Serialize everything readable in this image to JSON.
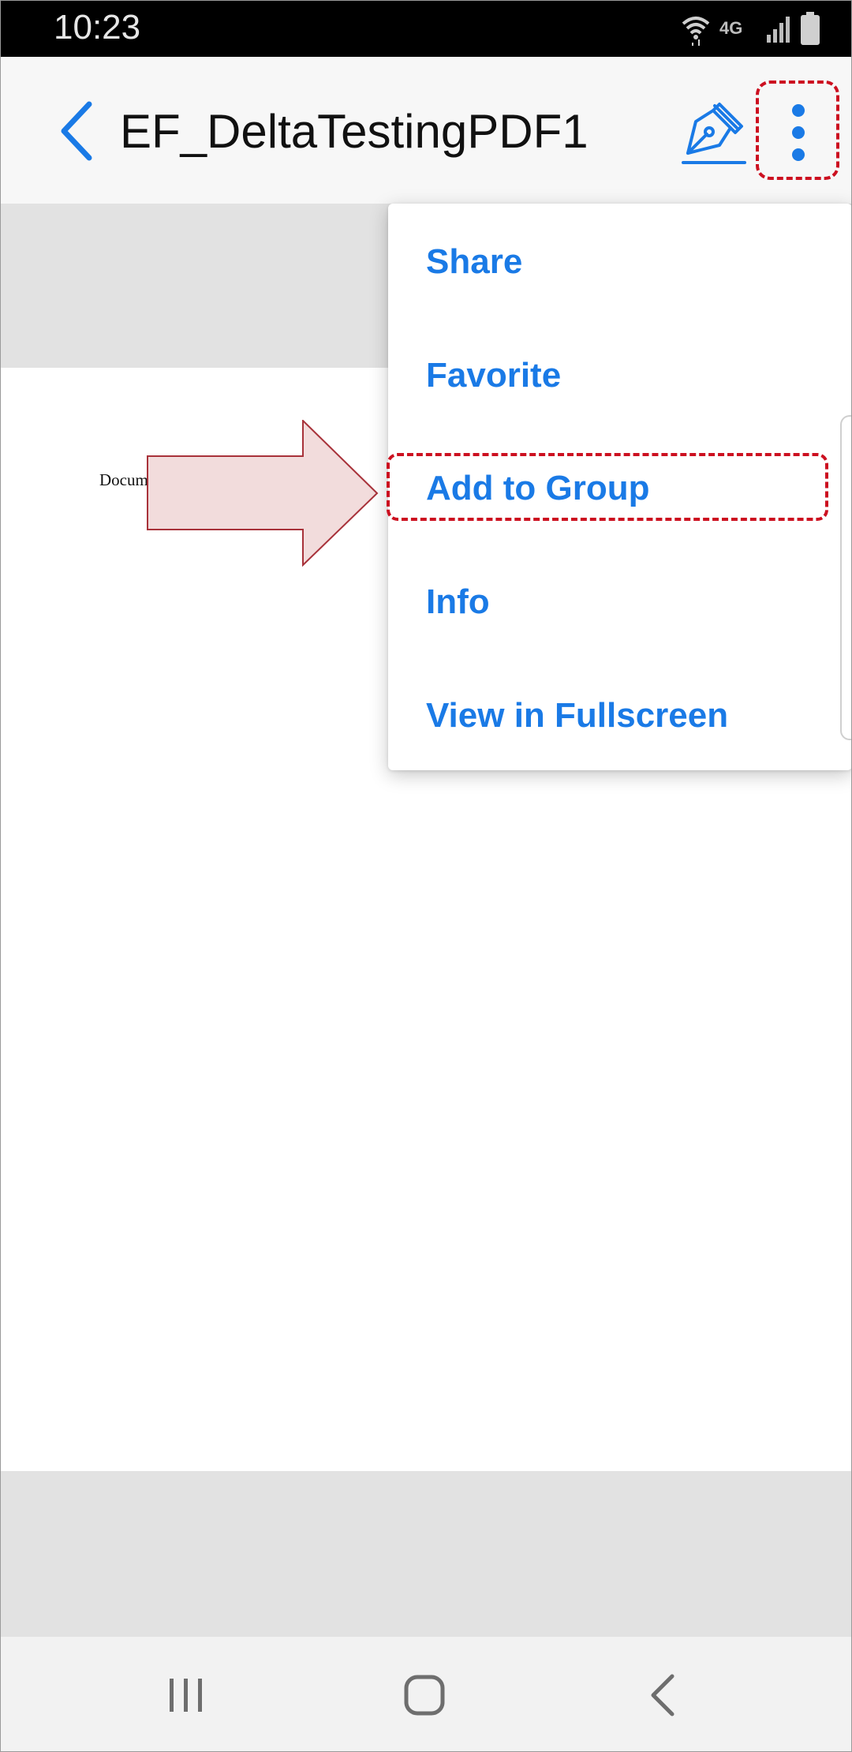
{
  "status_bar": {
    "time": "10:23",
    "network_label": "4G"
  },
  "app_bar": {
    "title": "EF_DeltaTestingPDF1"
  },
  "document": {
    "visible_text": "Docum"
  },
  "menu": {
    "items": [
      {
        "label": "Share"
      },
      {
        "label": "Favorite"
      },
      {
        "label": "Add to Group"
      },
      {
        "label": "Info"
      },
      {
        "label": "View in Fullscreen"
      }
    ]
  },
  "colors": {
    "accent": "#1a7ae6",
    "highlight": "#cc1020",
    "arrow_fill": "#f2dcdc",
    "arrow_stroke": "#a8323a"
  }
}
